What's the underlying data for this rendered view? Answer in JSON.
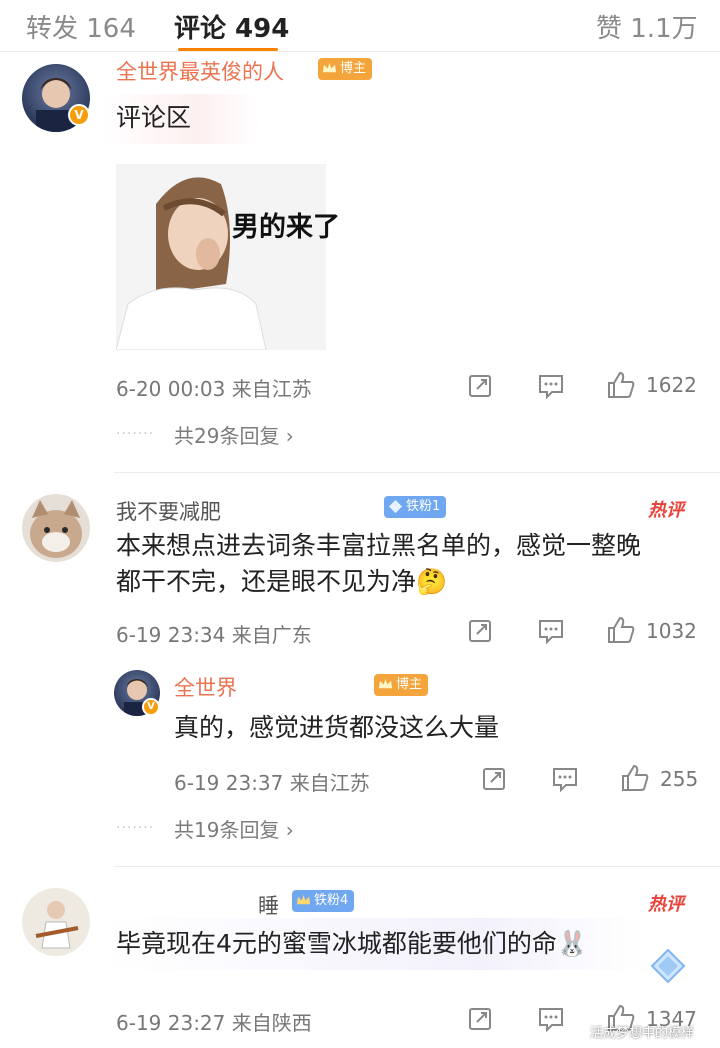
{
  "tabs": {
    "repost": "转发 164",
    "comments": "评论 494",
    "likes": "赞 1.1万"
  },
  "comments": [
    {
      "username": "全世界最英俊的人",
      "badge": "博主",
      "text": "评论区",
      "sticker_text": "男的来了",
      "meta": "6-20 00:03  来自江苏",
      "likes": "1622",
      "replies_link": "共29条回复 ›"
    },
    {
      "username": "我不要减肥",
      "badge": "铁粉1",
      "hot": "热评",
      "text_line1": "本来想点进去词条丰富拉黑名单的，感觉一整晚",
      "text_line2": "都干不完，还是眼不见为净🤔",
      "meta": "6-19 23:34  来自广东",
      "likes": "1032",
      "reply": {
        "username": "全世界",
        "badge": "博主",
        "text": "真的，感觉进货都没这么大量",
        "meta": "6-19 23:37  来自江苏",
        "likes": "255"
      },
      "replies_link": "共19条回复 ›"
    },
    {
      "username": "睡",
      "badge": "铁粉4",
      "hot": "热评",
      "text": "毕竟现在4元的蜜雪冰城都能要他们的命🐰",
      "meta": "6-19 23:27  来自陕西",
      "likes": "1347"
    }
  ],
  "watermark": "活成梦想中的模样",
  "icons": [
    "repost-icon",
    "comment-icon",
    "like-icon",
    "verified-icon",
    "crown-icon",
    "diamond-icon"
  ],
  "colors": {
    "accent": "#ff8200",
    "hot": "#e8443b",
    "blogger_badge": "#f3a43b",
    "fan_badge": "#6fa7f1"
  }
}
